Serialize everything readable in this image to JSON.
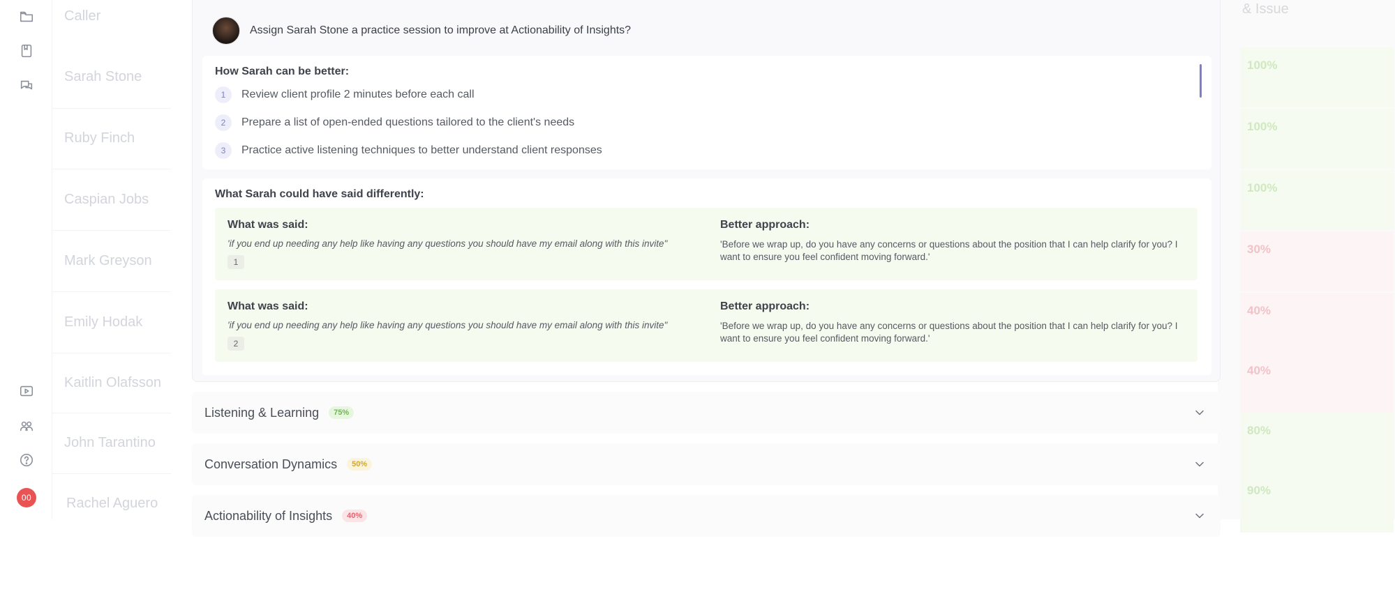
{
  "background": {
    "column_header": "Caller",
    "right_header": "& Issue",
    "callers": [
      "Sarah Stone",
      "Ruby Finch",
      "Caspian Jobs",
      "Mark Greyson",
      "Emily Hodak",
      "Kaitlin Olafsson",
      "John Tarantino",
      "Rachel Aguero"
    ],
    "scores": [
      {
        "value": "100%",
        "status": "green"
      },
      {
        "value": "100%",
        "status": "green"
      },
      {
        "value": "100%",
        "status": "green"
      },
      {
        "value": "30%",
        "status": "red"
      },
      {
        "value": "40%",
        "status": "red"
      },
      {
        "value": "40%",
        "status": "red"
      },
      {
        "value": "80%",
        "status": "green"
      },
      {
        "value": "90%",
        "status": "green"
      }
    ]
  },
  "rail": {
    "icons": [
      "folder-icon",
      "bookmark-icon",
      "chat-icon",
      "video-icon",
      "users-icon",
      "help-icon"
    ],
    "avatar_badge": "00"
  },
  "panel": {
    "question": "Assign Sarah Stone a practice session to improve at Actionability of Insights?",
    "improve": {
      "title": "How Sarah can be better:",
      "steps": [
        {
          "num": "1",
          "text": "Review client profile 2 minutes before each call"
        },
        {
          "num": "2",
          "text": "Prepare a list of open-ended questions tailored to the client's needs"
        },
        {
          "num": "3",
          "text": "Practice active listening techniques to better understand client responses"
        }
      ]
    },
    "differently": {
      "title": "What Sarah could have said differently:",
      "said_label": "What was said:",
      "better_label": "Better approach:",
      "examples": [
        {
          "said": "'if you end up needing any help  like having any questions  you should have  my email along  with this invite\"",
          "count": "1",
          "better": "'Before we wrap up, do you have any concerns or questions about the position that I can help clarify for you? I want to ensure you feel confident moving forward.'"
        },
        {
          "said": "'if you end up needing any help  like having any questions  you should have  my email along  with this invite\"",
          "count": "2",
          "better": "'Before we wrap up, do you have any concerns or questions about the position that I can help clarify for you? I want to ensure you feel confident moving forward.'"
        }
      ]
    }
  },
  "accordions": [
    {
      "title": "Listening & Learning",
      "badge": "75%",
      "status": "green"
    },
    {
      "title": "Conversation Dynamics",
      "badge": "50%",
      "status": "yellow"
    },
    {
      "title": "Actionability of Insights",
      "badge": "40%",
      "status": "red"
    }
  ],
  "colors": {
    "accent": "#7c7fd0",
    "good": "#6fb552",
    "warn": "#d3a72a",
    "bad": "#e2636d",
    "avatar": "#ea5353"
  }
}
